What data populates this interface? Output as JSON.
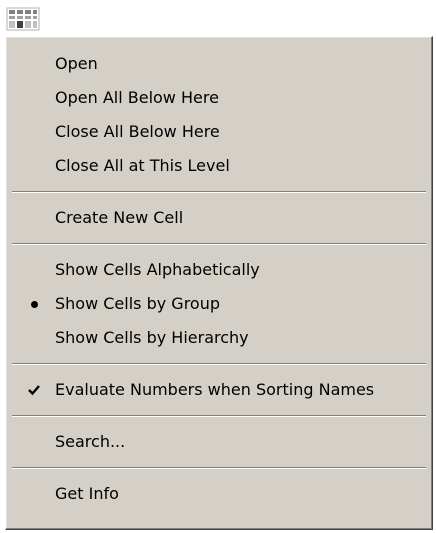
{
  "menu": {
    "groups": [
      {
        "items": [
          {
            "label": "Open",
            "mark": ""
          },
          {
            "label": "Open All Below Here",
            "mark": ""
          },
          {
            "label": "Close All Below Here",
            "mark": ""
          },
          {
            "label": "Close All at This Level",
            "mark": ""
          }
        ]
      },
      {
        "items": [
          {
            "label": "Create New Cell",
            "mark": ""
          }
        ]
      },
      {
        "items": [
          {
            "label": "Show Cells Alphabetically",
            "mark": ""
          },
          {
            "label": "Show Cells by Group",
            "mark": "bullet"
          },
          {
            "label": "Show Cells by Hierarchy",
            "mark": ""
          }
        ]
      },
      {
        "items": [
          {
            "label": "Evaluate Numbers when Sorting Names",
            "mark": "check"
          }
        ]
      },
      {
        "items": [
          {
            "label": "Search...",
            "mark": ""
          }
        ]
      },
      {
        "items": [
          {
            "label": "Get Info",
            "mark": ""
          }
        ]
      }
    ]
  },
  "icons": {
    "top": "cell-hierarchy-icon"
  },
  "colors": {
    "menu_bg": "#d4d0c8",
    "text": "#000000"
  }
}
